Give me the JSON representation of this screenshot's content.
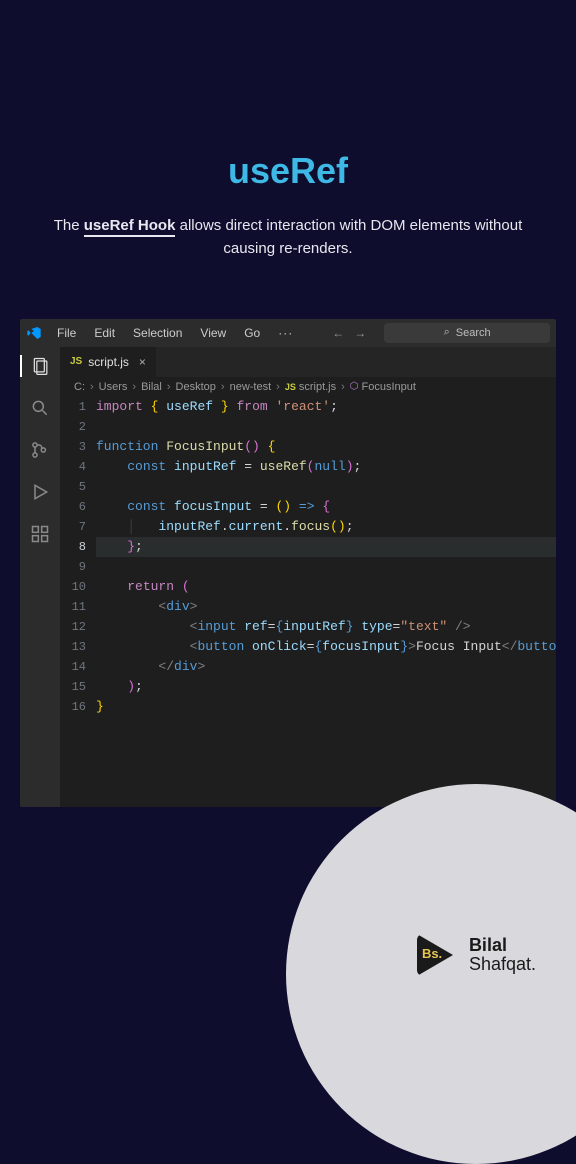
{
  "hero": {
    "title": "useRef",
    "sub_prefix": "The ",
    "sub_highlight": "useRef Hook",
    "sub_suffix": " allows direct interaction with DOM elements without causing re-renders."
  },
  "menu": {
    "file": "File",
    "edit": "Edit",
    "selection": "Selection",
    "view": "View",
    "go": "Go",
    "more": "···"
  },
  "nav": {
    "back": "←",
    "fwd": "→"
  },
  "search": {
    "icon": "⌕",
    "placeholder": "Search"
  },
  "tab": {
    "icon": "JS",
    "name": "script.js",
    "close": "×"
  },
  "breadcrumbs": {
    "parts": [
      "C:",
      "Users",
      "Bilal",
      "Desktop",
      "new-test"
    ],
    "js_icon": "JS",
    "file": "script.js",
    "sym_icon": "⬡",
    "symbol": "FocusInput",
    "sep": "›"
  },
  "lines": [
    "1",
    "2",
    "3",
    "4",
    "5",
    "6",
    "7",
    "8",
    "9",
    "10",
    "11",
    "12",
    "13",
    "14",
    "15",
    "16"
  ],
  "code": {
    "l1": {
      "import": "import",
      "brace_o": "{",
      "useRef": " useRef ",
      "brace_c": "}",
      "from": " from ",
      "react": "'react'",
      "semi": ";"
    },
    "l3": {
      "fn": "function",
      "name": " FocusInput",
      "paren": "()",
      "brace": " {"
    },
    "l4": {
      "const": "const",
      "var": " inputRef ",
      "eq": "= ",
      "call": "useRef",
      "po": "(",
      "null": "null",
      "pc": ")",
      "semi": ";"
    },
    "l6": {
      "const": "const",
      "var": " focusInput ",
      "eq": "= ",
      "po": "(",
      "pc": ")",
      "arrow": " => ",
      "brace": "{"
    },
    "l7": {
      "obj": "inputRef",
      "dot1": ".",
      "cur": "current",
      "dot2": ".",
      "focus": "focus",
      "po": "(",
      "pc": ")",
      "semi": ";"
    },
    "l8": {
      "brace": "}",
      "semi": ";"
    },
    "l10": {
      "ret": "return",
      "paren": " ("
    },
    "l11": {
      "lt": "<",
      "div": "div",
      "gt": ">"
    },
    "l12": {
      "lt": "<",
      "input": "input",
      "ref": " ref",
      "eq": "=",
      "bo": "{",
      "var": "inputRef",
      "bc": "}",
      "type": " type",
      "eq2": "=",
      "q": "\"text\"",
      "sl": " /",
      "gt": ">"
    },
    "l13": {
      "lt": "<",
      "button": "button",
      "onclick": " onClick",
      "eq": "=",
      "bo": "{",
      "var": "focusInput",
      "bc": "}",
      "gt": ">",
      "text": "Focus Input",
      "lt2": "</",
      "button2": "button",
      "gt2": ">"
    },
    "l14": {
      "lt": "</",
      "div": "div",
      "gt": ">"
    },
    "l15": {
      "pc": ")",
      "semi": ";"
    },
    "l16": {
      "brace": "}"
    }
  },
  "brand": {
    "badge": "Bs.",
    "line1": "Bilal",
    "line2": "Shafqat."
  }
}
